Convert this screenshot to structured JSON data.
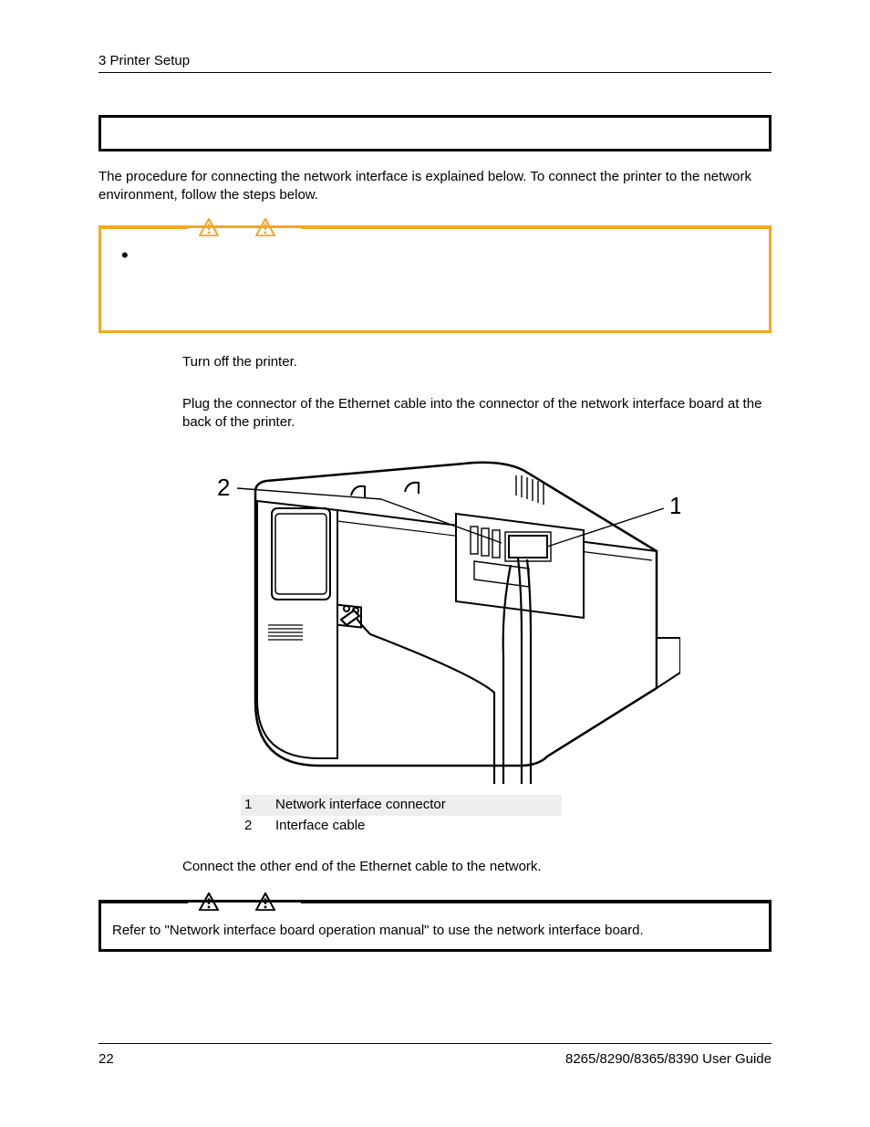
{
  "header": {
    "section": "3 Printer Setup"
  },
  "title_box": "",
  "intro": "The procedure for connecting the network interface is explained below.  To connect the printer to the network environment, follow the steps below.",
  "caution_box": {
    "bullet": "•",
    "text": ""
  },
  "steps": {
    "s1": "Turn off the printer.",
    "s2": "Plug the connector of the Ethernet cable into the connector of the network interface board at the back of the printer.",
    "s3": "Connect the other end of the Ethernet cable to the network."
  },
  "figure": {
    "callout1": "1",
    "callout2": "2",
    "legend": [
      {
        "n": "1",
        "t": "Network interface connector"
      },
      {
        "n": "2",
        "t": "Interface cable"
      }
    ]
  },
  "notes_box": {
    "text": "Refer to \"Network interface board operation manual\" to use the network interface board."
  },
  "footer": {
    "page": "22",
    "doc": "8265/8290/8365/8390 User Guide"
  }
}
